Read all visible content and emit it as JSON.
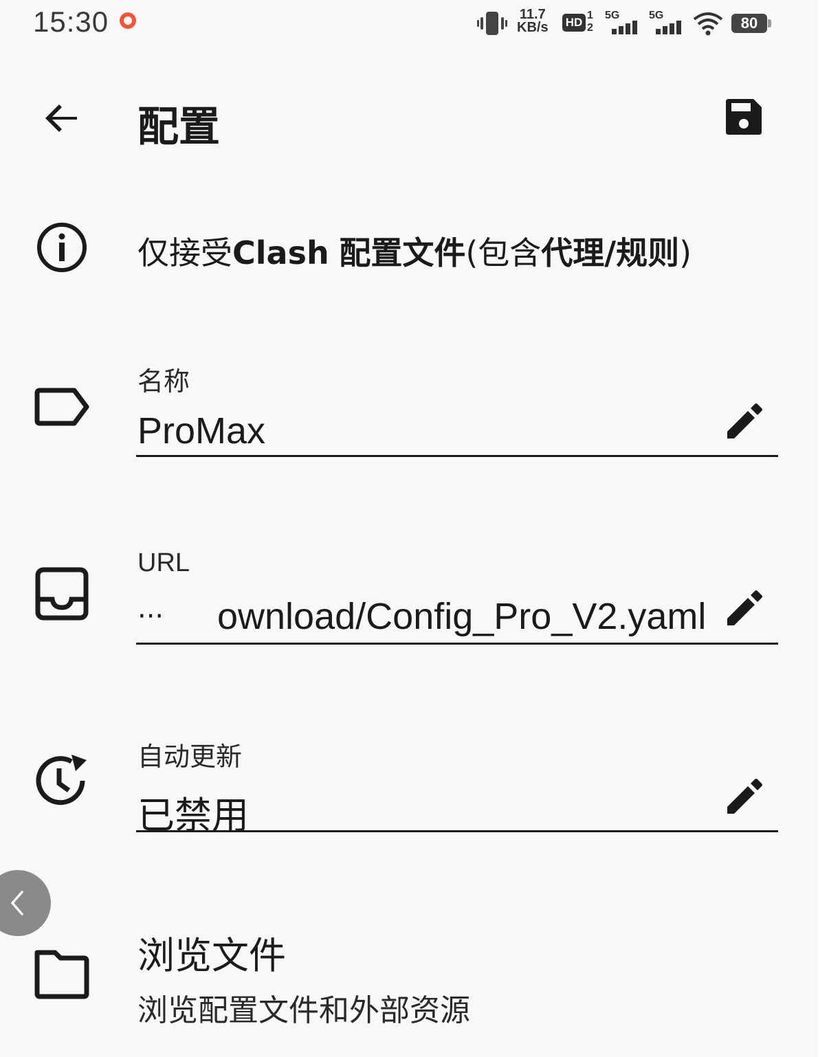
{
  "status_bar": {
    "time": "15:30",
    "net_speed_value": "11.7",
    "net_speed_unit": "KB/s",
    "hd_badge": "HD",
    "sim1_label": "5G",
    "sim2_label": "5G",
    "battery_level": "80",
    "recording_color": "#f2553a"
  },
  "app_bar": {
    "title": "配置",
    "back_icon": "arrow-left-icon",
    "save_icon": "save-icon"
  },
  "info": {
    "icon": "info-icon",
    "text_parts": [
      "仅接受",
      "Clash",
      " ",
      "配置文件",
      "(包含",
      "代理/规则",
      ")"
    ]
  },
  "fields": {
    "name": {
      "label": "名称",
      "value": "ProMax",
      "icon": "label-tag-icon"
    },
    "url": {
      "label": "URL",
      "prefix": "···",
      "value": "ownload/Config_Pro_V2.yaml",
      "icon": "inbox-icon"
    },
    "auto_update": {
      "label": "自动更新",
      "value": "已禁用",
      "icon": "update-clock-icon"
    }
  },
  "browse": {
    "title": "浏览文件",
    "subtitle": "浏览配置文件和外部资源",
    "icon": "folder-icon"
  },
  "floating_back": {
    "icon": "chevron-left-icon"
  }
}
